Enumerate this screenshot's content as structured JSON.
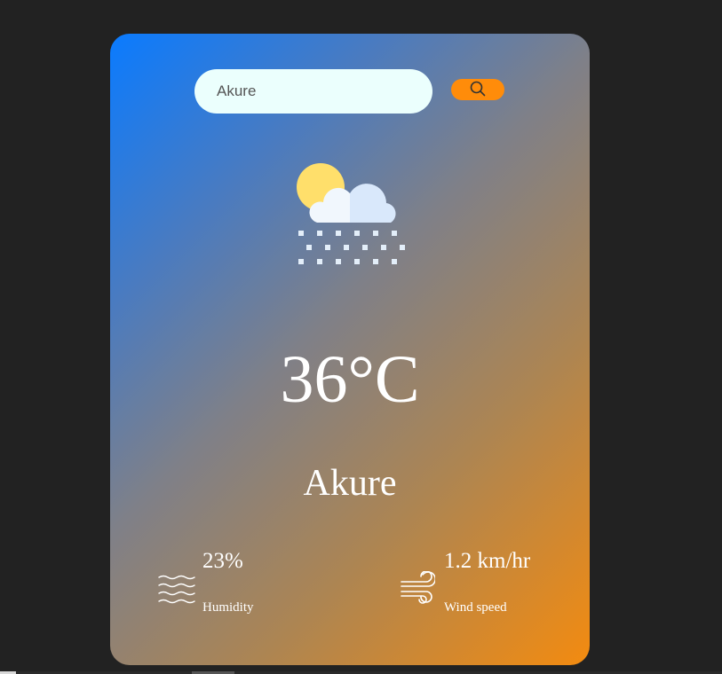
{
  "search": {
    "value": "Akure",
    "button_icon": "search-icon"
  },
  "weather": {
    "icon": "sun-cloud-snow-icon",
    "temperature": "36°C",
    "city": "Akure"
  },
  "humidity": {
    "icon": "humidity-waves-icon",
    "value": "23%",
    "label": "Humidity"
  },
  "wind": {
    "icon": "wind-icon",
    "value": "1.2 km/hr",
    "label": "Wind speed"
  },
  "colors": {
    "page_background": "#222222",
    "gradient_start": "#0a7bff",
    "gradient_end": "#f38b10",
    "search_button": "#ff8c0a",
    "search_field": "#ebfffd"
  }
}
